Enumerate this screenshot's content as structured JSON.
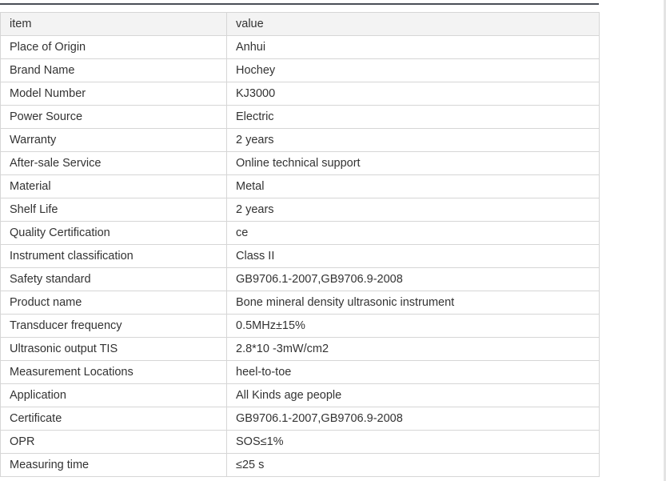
{
  "table": {
    "header": {
      "item": "item",
      "value": "value"
    },
    "rows": [
      {
        "item": "Place of Origin",
        "value": "Anhui"
      },
      {
        "item": "Brand Name",
        "value": "Hochey"
      },
      {
        "item": "Model Number",
        "value": "KJ3000"
      },
      {
        "item": "Power Source",
        "value": "Electric"
      },
      {
        "item": "Warranty",
        "value": "2 years"
      },
      {
        "item": "After-sale Service",
        "value": "Online technical support"
      },
      {
        "item": "Material",
        "value": "Metal"
      },
      {
        "item": "Shelf Life",
        "value": "2 years"
      },
      {
        "item": "Quality Certification",
        "value": "ce"
      },
      {
        "item": "Instrument classification",
        "value": "Class II"
      },
      {
        "item": "Safety standard",
        "value": "GB9706.1-2007,GB9706.9-2008"
      },
      {
        "item": "Product name",
        "value": "Bone mineral density ultrasonic instrument"
      },
      {
        "item": "Transducer frequency",
        "value": "0.5MHz±15%"
      },
      {
        "item": "Ultrasonic output TIS",
        "value": "2.8*10 -3mW/cm2"
      },
      {
        "item": "Measurement Locations",
        "value": "heel-to-toe"
      },
      {
        "item": "Application",
        "value": "All Kinds age people"
      },
      {
        "item": "Certificate",
        "value": "GB9706.1-2007,GB9706.9-2008"
      },
      {
        "item": "OPR",
        "value": "SOS≤1%"
      },
      {
        "item": "Measuring time",
        "value": "≤25 s"
      }
    ]
  }
}
